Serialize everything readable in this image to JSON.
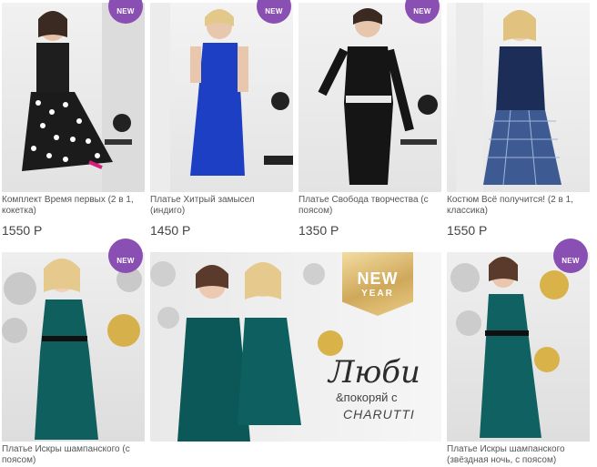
{
  "badge": "NEW",
  "products_row1": [
    {
      "title": "Комплект Время первых (2 в 1, кокетка)",
      "price": "1550 Р",
      "new": true
    },
    {
      "title": "Платье Хитрый замысел (индиго)",
      "price": "1450 Р",
      "new": true
    },
    {
      "title": "Платье Свобода творчества (с поясом)",
      "price": "1350 Р",
      "new": true
    },
    {
      "title": "Костюм Всё получится! (2 в 1, классика)",
      "price": "1550 Р",
      "new": false
    }
  ],
  "products_row2": [
    {
      "title": "Платье Искры шампанского (с поясом)",
      "new": true
    },
    {
      "title": "Платье Искры шампанского (звёздная ночь, с поясом)",
      "new": true
    }
  ],
  "banner": {
    "new": "NEW",
    "year": "YEAR",
    "script": "Люби",
    "line1": "&покоряй с",
    "line2": "CHARUTTI"
  },
  "colors": {
    "badge": "#8a4fb3",
    "gold": "#cfa85a",
    "emerald": "#0f5f5f"
  }
}
